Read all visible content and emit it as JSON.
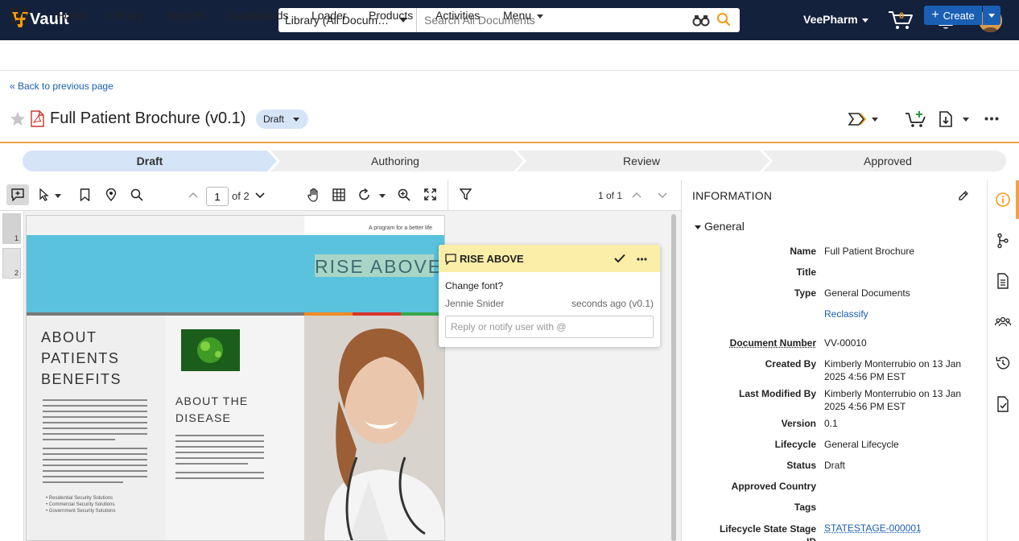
{
  "app": {
    "name": "Vault"
  },
  "search": {
    "scope": "Library (All Docum…",
    "placeholder": "Search All Documents"
  },
  "header": {
    "vault_name": "VeePharm",
    "cart_count": "0"
  },
  "nav": {
    "items": [
      "Home",
      "Library",
      "Reports",
      "Dashboards",
      "Loader",
      "Products",
      "Activities",
      "Menu"
    ],
    "create_label": "Create"
  },
  "breadcrumb": {
    "back": "« Back to previous page"
  },
  "document": {
    "title": "Full Patient Brochure (v0.1)",
    "status": "Draft"
  },
  "lifecycle": {
    "stages": [
      "Draft",
      "Authoring",
      "Review",
      "Approved"
    ],
    "current": "Draft"
  },
  "viewer": {
    "page": "1",
    "of_pages": "of 2",
    "annotation_count": "1 of 1",
    "thumb_pages": [
      "1",
      "2"
    ]
  },
  "brochure": {
    "tagline": "A program for a better life",
    "headline": "RISE ABOVE",
    "col1_title": "ABOUT PATIENTS BENEFITS",
    "col2_title": "ABOUT THE DISEASE",
    "bullets": [
      "Residential Security Solutions",
      "Commercial Security Solutions",
      "Government Security Solutions"
    ]
  },
  "comment": {
    "title": "RISE ABOVE",
    "body": "Change font?",
    "author": "Jennie Snider",
    "time": "seconds ago (v0.1)",
    "reply_placeholder": "Reply or notify user with @"
  },
  "info": {
    "heading": "INFORMATION",
    "section": "General",
    "fields": [
      {
        "label": "Name",
        "value": "Full Patient Brochure"
      },
      {
        "label": "Title",
        "value": ""
      },
      {
        "label": "Type",
        "value": "General Documents"
      },
      {
        "label": "",
        "value": "Reclassify"
      },
      {
        "label": "Document Number",
        "value": "VV-00010"
      },
      {
        "label": "Created By",
        "value": "Kimberly Monterrubio on 13 Jan 2025 4:56 PM EST"
      },
      {
        "label": "Last Modified By",
        "value": "Kimberly Monterrubio on 13 Jan 2025 4:56 PM EST"
      },
      {
        "label": "Version",
        "value": "0.1"
      },
      {
        "label": "Lifecycle",
        "value": "General Lifecycle"
      },
      {
        "label": "Status",
        "value": "Draft"
      },
      {
        "label": "Approved Country",
        "value": ""
      },
      {
        "label": "Tags",
        "value": ""
      },
      {
        "label": "Lifecycle State Stage ID",
        "value": "STATESTAGE-000001"
      }
    ]
  },
  "colors": {
    "topbar": "#14213d",
    "accent": "#f0a14a",
    "primary": "#1a5fb4",
    "comment_head": "#fbeea8",
    "stage_active": "#d6e4f7"
  }
}
